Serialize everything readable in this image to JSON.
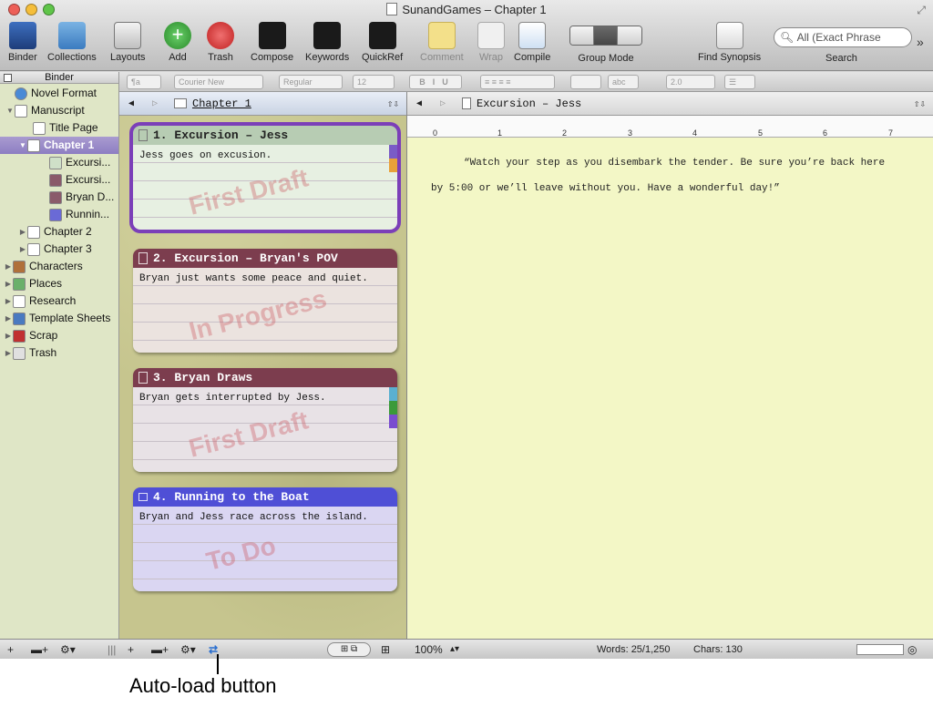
{
  "window": {
    "title": "SunandGames – Chapter 1"
  },
  "toolbar": {
    "items": [
      {
        "label": "Binder",
        "icon": "binder-icon"
      },
      {
        "label": "Collections",
        "icon": "collections-icon"
      },
      {
        "label": "Layouts",
        "icon": "layouts-icon"
      },
      {
        "label": "Add",
        "icon": "add-icon"
      },
      {
        "label": "Trash",
        "icon": "trash-icon"
      },
      {
        "label": "Compose",
        "icon": "compose-icon"
      },
      {
        "label": "Keywords",
        "icon": "keywords-icon"
      },
      {
        "label": "QuickRef",
        "icon": "quickref-icon"
      },
      {
        "label": "Comment",
        "icon": "comment-icon"
      },
      {
        "label": "Wrap",
        "icon": "wrap-icon"
      },
      {
        "label": "Compile",
        "icon": "compile-icon"
      },
      {
        "label": "Group Mode",
        "icon": "group-mode-icon"
      },
      {
        "label": "Find Synopsis",
        "icon": "find-synopsis-icon"
      }
    ],
    "search_value": "All (Exact Phrase",
    "search_label": "Search"
  },
  "format_bar": {
    "style": "¶a",
    "font": "Courier New",
    "weight": "Regular",
    "size": "12",
    "line_spacing": "2.0"
  },
  "binder": {
    "title": "Binder",
    "items": [
      {
        "label": "Novel Format"
      },
      {
        "label": "Manuscript"
      },
      {
        "label": "Title Page"
      },
      {
        "label": "Chapter 1"
      },
      {
        "label": "Excursi..."
      },
      {
        "label": "Excursi..."
      },
      {
        "label": "Bryan D..."
      },
      {
        "label": "Runnin..."
      },
      {
        "label": "Chapter 2"
      },
      {
        "label": "Chapter 3"
      },
      {
        "label": "Characters"
      },
      {
        "label": "Places"
      },
      {
        "label": "Research"
      },
      {
        "label": "Template Sheets"
      },
      {
        "label": "Scrap"
      },
      {
        "label": "Trash"
      }
    ]
  },
  "corkboard": {
    "header": "Chapter 1",
    "cards": [
      {
        "title": "1. Excursion – Jess",
        "synopsis": "Jess goes on excusion.",
        "status": "First Draft",
        "color": "#cfe0c8",
        "title_color": "#7ea07a",
        "labels": [
          "#7a5cc7",
          "#e9a13a"
        ]
      },
      {
        "title": "2. Excursion – Bryan's POV",
        "synopsis": "Bryan just wants some peace and quiet.",
        "status": "In Progress",
        "color": "#e6dcd6",
        "title_color": "#7c3d4e",
        "labels": []
      },
      {
        "title": "3. Bryan Draws",
        "synopsis": "Bryan gets interrupted by Jess.",
        "status": "First Draft",
        "color": "#e2dce0",
        "title_color": "#7c3d4e",
        "labels": [
          "#5ab0d0",
          "#3a9a3a",
          "#7a4cd0"
        ]
      },
      {
        "title": "4. Running to the Boat",
        "synopsis": "Bryan and Jess race across the island.",
        "status": "To Do",
        "color": "#d6d2ee",
        "title_color": "#4f4fd6",
        "labels": []
      }
    ]
  },
  "editor": {
    "header": "Excursion – Jess",
    "text": "“Watch your step as you disembark the tender. Be sure you’re back here by 5:00 or we’ll leave without you. Have a wonderful day!”",
    "ruler": [
      "0",
      "1",
      "2",
      "3",
      "4",
      "5",
      "6",
      "7"
    ]
  },
  "status": {
    "zoom": "100%",
    "words": "Words: 25/1,250",
    "chars": "Chars: 130"
  },
  "annotation": "Auto-load button"
}
